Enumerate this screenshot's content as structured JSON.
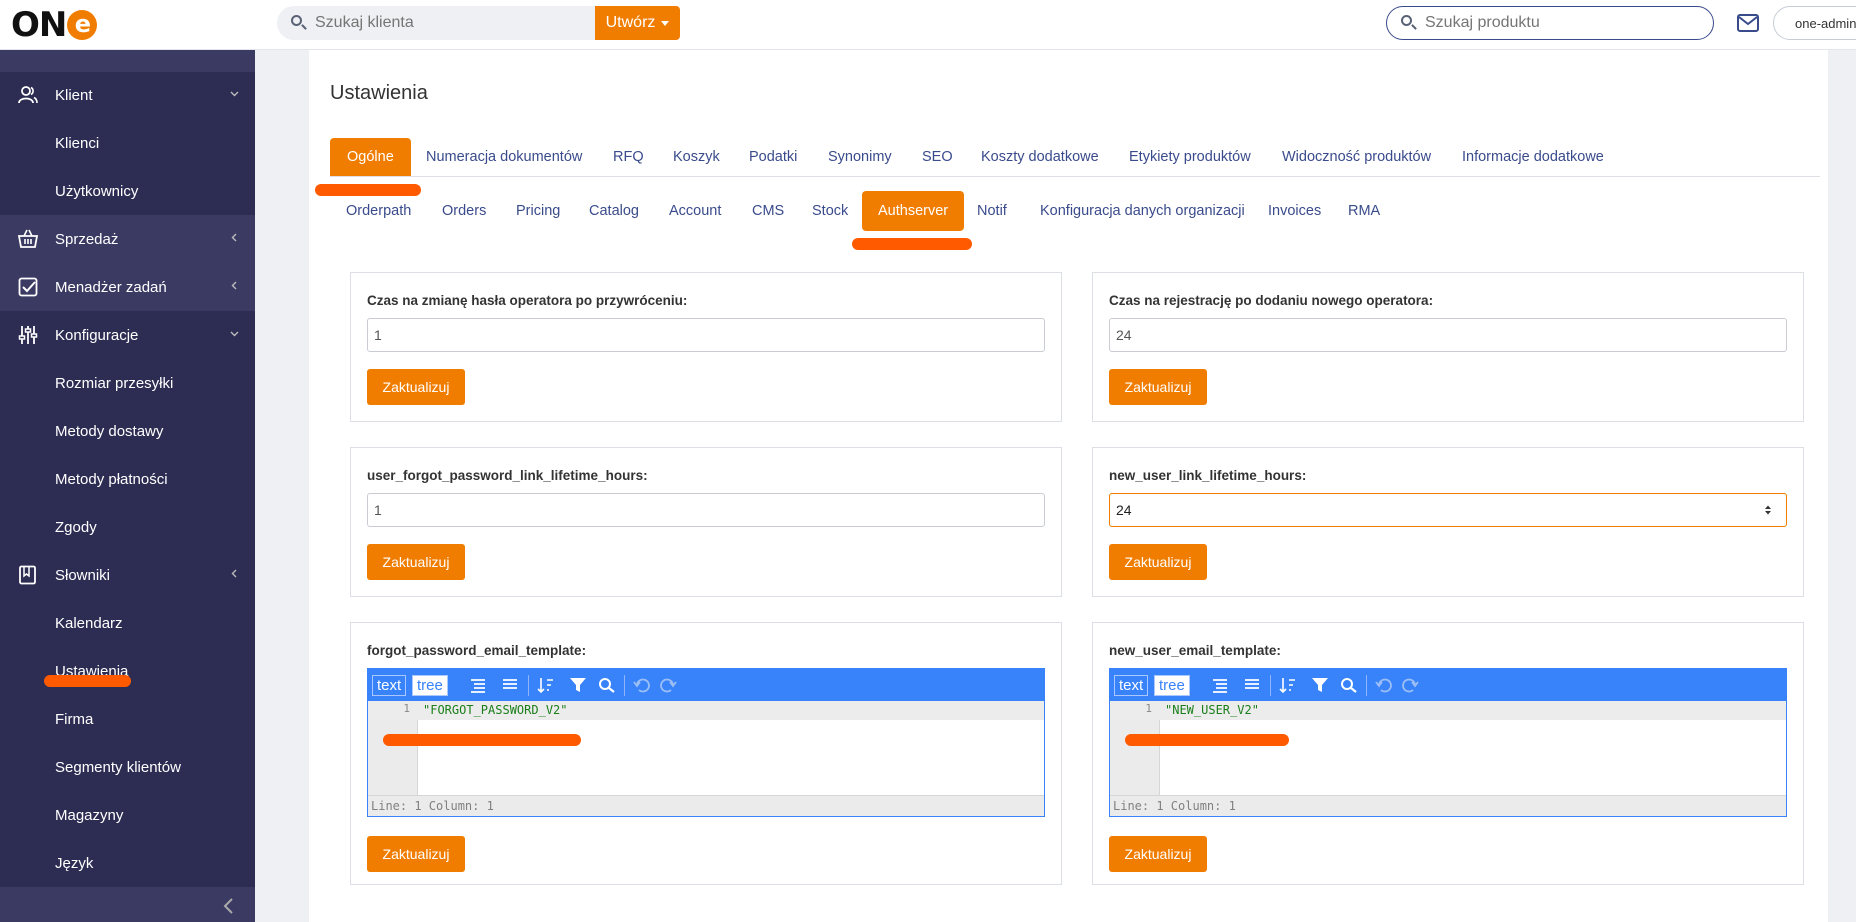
{
  "header": {
    "logo_text": "ON",
    "logo_e": "e",
    "client_search_placeholder": "Szukaj klienta",
    "create_label": "Utwórz",
    "product_search_placeholder": "Szukaj produktu",
    "user_label": "one-admin"
  },
  "sidebar": {
    "groups": [
      {
        "label": "Klient",
        "icon": "users-icon",
        "expanded": true
      },
      {
        "label": "Sprzedaż",
        "icon": "basket-icon",
        "expanded": false
      },
      {
        "label": "Menadżer zadań",
        "icon": "checkbox-icon",
        "expanded": false
      },
      {
        "label": "Konfiguracje",
        "icon": "sliders-icon",
        "expanded": true
      },
      {
        "label": "Słowniki",
        "icon": "book-icon",
        "expanded": false
      }
    ],
    "items": [
      {
        "label": "Klienci"
      },
      {
        "label": "Użytkownicy"
      },
      {
        "label": "Rozmiar przesyłki"
      },
      {
        "label": "Metody dostawy"
      },
      {
        "label": "Metody płatności"
      },
      {
        "label": "Zgody"
      },
      {
        "label": "Kalendarz"
      },
      {
        "label": "Ustawienia",
        "active": true
      },
      {
        "label": "Firma"
      },
      {
        "label": "Segmenty klientów"
      },
      {
        "label": "Magazyny"
      },
      {
        "label": "Język"
      }
    ]
  },
  "main": {
    "title": "Ustawienia",
    "tabs": [
      "Ogólne",
      "Numeracja dokumentów",
      "RFQ",
      "Koszyk",
      "Podatki",
      "Synonimy",
      "SEO",
      "Koszty dodatkowe",
      "Etykiety produktów",
      "Widoczność produktów",
      "Informacje dodatkowe"
    ],
    "active_tab": "Ogólne",
    "subtabs": [
      "Orderpath",
      "Orders",
      "Pricing",
      "Catalog",
      "Account",
      "CMS",
      "Stock",
      "Authserver",
      "Notif",
      "Konfiguracja danych organizacji",
      "Invoices",
      "RMA"
    ],
    "active_subtab": "Authserver",
    "update_label": "Zaktualizuj",
    "cards": [
      {
        "label": "Czas na zmianę hasła operatora po przywróceniu:",
        "value": "1"
      },
      {
        "label": "Czas na rejestrację po dodaniu nowego operatora:",
        "value": "24"
      },
      {
        "label": "user_forgot_password_link_lifetime_hours:",
        "value": "1"
      },
      {
        "label": "new_user_link_lifetime_hours:",
        "value": "24"
      },
      {
        "label": "forgot_password_email_template:",
        "code": "\"FORGOT_PASSWORD_V2\""
      },
      {
        "label": "new_user_email_template:",
        "code": "\"NEW_USER_V2\""
      }
    ],
    "editor": {
      "mode_text": "text",
      "mode_tree": "tree",
      "line_number": "1",
      "status": "Line: 1  Column: 1"
    }
  },
  "colors": {
    "accent": "#f07d00",
    "sidebar_bg": "#2d2d54",
    "link": "#3a4b8c",
    "editor_blue": "#3883fa",
    "highlight": "#ff5a00"
  }
}
